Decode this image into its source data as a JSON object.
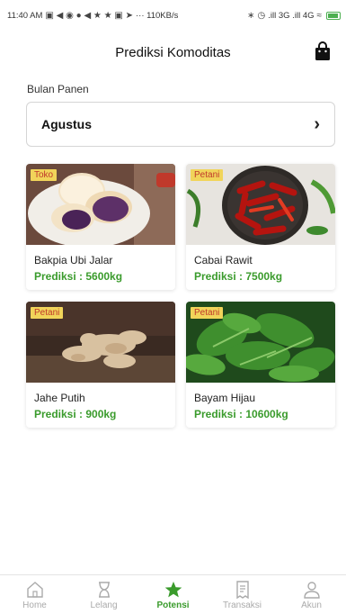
{
  "status_bar": {
    "time": "11:40 AM",
    "network": "··· 110KB/s",
    "signal": ".ill 3G .ill 4G"
  },
  "header": {
    "title": "Prediksi Komoditas",
    "cart_icon": "shopping-bag-icon"
  },
  "harvest": {
    "label": "Bulan Panen",
    "selected_month": "Agustus"
  },
  "products": [
    {
      "badge": "Toko",
      "name": "Bakpia Ubi Jalar",
      "prediction": "Prediksi : 5600kg"
    },
    {
      "badge": "Petani",
      "name": "Cabai Rawit",
      "prediction": "Prediksi : 7500kg"
    },
    {
      "badge": "Petani",
      "name": "Jahe Putih",
      "prediction": "Prediksi : 900kg"
    },
    {
      "badge": "Petani",
      "name": "Bayam Hijau",
      "prediction": "Prediksi : 10600kg"
    }
  ],
  "nav": {
    "home": "Home",
    "lelang": "Lelang",
    "potensi": "Potensi",
    "transaksi": "Transaksi",
    "akun": "Akun",
    "active": "Potensi"
  },
  "colors": {
    "accent": "#3a9b2c",
    "badge_bg": "#f1d45a",
    "badge_text": "#c0392b"
  }
}
